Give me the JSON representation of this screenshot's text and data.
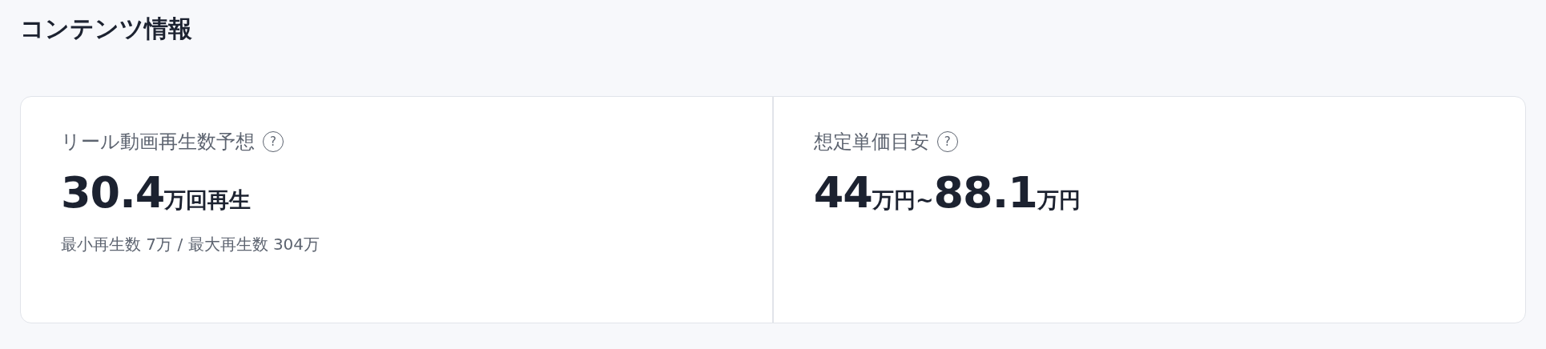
{
  "section_title": "コンテンツ情報",
  "metrics": [
    {
      "label": "リール動画再生数予想",
      "help_icon": "?",
      "value": [
        {
          "kind": "number",
          "text": "30.4"
        },
        {
          "kind": "unit",
          "text": "万回再生"
        }
      ],
      "note": "最小再生数 7万 / 最大再生数 304万"
    },
    {
      "label": "想定単価目安",
      "help_icon": "?",
      "value": [
        {
          "kind": "number",
          "text": "44"
        },
        {
          "kind": "unit",
          "text": "万円~"
        },
        {
          "kind": "number",
          "text": "88.1"
        },
        {
          "kind": "unit",
          "text": "万円"
        }
      ]
    }
  ]
}
